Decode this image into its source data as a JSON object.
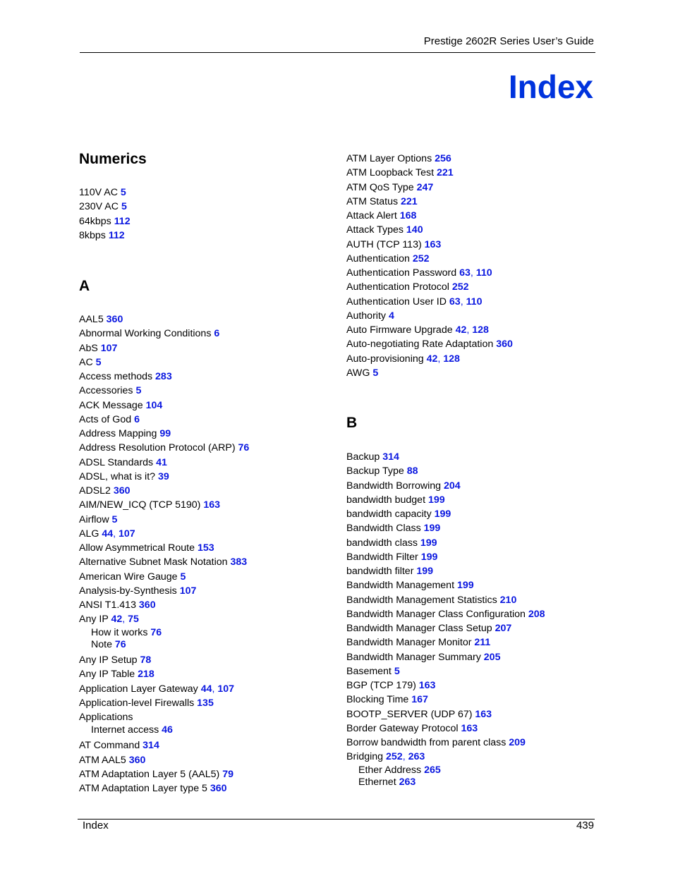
{
  "header": {
    "guide_title": "Prestige 2602R Series User’s Guide"
  },
  "page_title": "Index",
  "left_column": {
    "sections": [
      {
        "heading": "Numerics",
        "entries": [
          {
            "term": "110V AC",
            "pages": [
              "5"
            ]
          },
          {
            "term": "230V AC",
            "pages": [
              "5"
            ]
          },
          {
            "term": "64kbps",
            "pages": [
              "112"
            ]
          },
          {
            "term": "8kbps",
            "pages": [
              "112"
            ]
          }
        ]
      },
      {
        "heading": "A",
        "entries": [
          {
            "term": "AAL5",
            "pages": [
              "360"
            ]
          },
          {
            "term": "Abnormal Working Conditions",
            "pages": [
              "6"
            ]
          },
          {
            "term": "AbS",
            "pages": [
              "107"
            ]
          },
          {
            "term": "AC",
            "pages": [
              "5"
            ]
          },
          {
            "term": "Access methods",
            "pages": [
              "283"
            ]
          },
          {
            "term": "Accessories",
            "pages": [
              "5"
            ]
          },
          {
            "term": "ACK Message",
            "pages": [
              "104"
            ]
          },
          {
            "term": "Acts of God",
            "pages": [
              "6"
            ]
          },
          {
            "term": "Address Mapping",
            "pages": [
              "99"
            ]
          },
          {
            "term": "Address Resolution Protocol (ARP)",
            "pages": [
              "76"
            ]
          },
          {
            "term": "ADSL Standards",
            "pages": [
              "41"
            ]
          },
          {
            "term": "ADSL, what is it?",
            "pages": [
              "39"
            ]
          },
          {
            "term": "ADSL2",
            "pages": [
              "360"
            ]
          },
          {
            "term": "AIM/NEW_ICQ (TCP 5190)",
            "pages": [
              "163"
            ]
          },
          {
            "term": "Airflow",
            "pages": [
              "5"
            ]
          },
          {
            "term": "ALG",
            "pages": [
              "44",
              "107"
            ]
          },
          {
            "term": "Allow Asymmetrical Route",
            "pages": [
              "153"
            ]
          },
          {
            "term": "Alternative Subnet Mask Notation",
            "pages": [
              "383"
            ]
          },
          {
            "term": "American Wire Gauge",
            "pages": [
              "5"
            ]
          },
          {
            "term": "Analysis-by-Synthesis",
            "pages": [
              "107"
            ]
          },
          {
            "term": "ANSI T1.413",
            "pages": [
              "360"
            ]
          },
          {
            "term": "Any IP",
            "pages": [
              "42",
              "75"
            ]
          },
          {
            "term": "How it works",
            "pages": [
              "76"
            ],
            "sub": true
          },
          {
            "term": "Note",
            "pages": [
              "76"
            ],
            "sub": true
          },
          {
            "term": "Any IP Setup",
            "pages": [
              "78"
            ],
            "after_sub": true
          },
          {
            "term": "Any IP Table",
            "pages": [
              "218"
            ]
          },
          {
            "term": "Application Layer Gateway",
            "pages": [
              "44",
              "107"
            ]
          },
          {
            "term": "Application-level Firewalls",
            "pages": [
              "135"
            ]
          },
          {
            "term": "Applications",
            "pages": []
          },
          {
            "term": "Internet access",
            "pages": [
              "46"
            ],
            "sub": true
          },
          {
            "term": "AT Command",
            "pages": [
              "314"
            ],
            "after_sub": true
          },
          {
            "term": "ATM AAL5",
            "pages": [
              "360"
            ]
          },
          {
            "term": "ATM Adaptation Layer 5 (AAL5)",
            "pages": [
              "79"
            ]
          },
          {
            "term": "ATM Adaptation Layer type 5",
            "pages": [
              "360"
            ]
          }
        ]
      }
    ]
  },
  "right_column": {
    "sections": [
      {
        "heading": "",
        "entries": [
          {
            "term": "ATM Layer Options",
            "pages": [
              "256"
            ]
          },
          {
            "term": "ATM Loopback Test",
            "pages": [
              "221"
            ]
          },
          {
            "term": "ATM QoS Type",
            "pages": [
              "247"
            ]
          },
          {
            "term": "ATM Status",
            "pages": [
              "221"
            ]
          },
          {
            "term": "Attack Alert",
            "pages": [
              "168"
            ]
          },
          {
            "term": "Attack Types",
            "pages": [
              "140"
            ]
          },
          {
            "term": "AUTH (TCP 113)",
            "pages": [
              "163"
            ]
          },
          {
            "term": "Authentication",
            "pages": [
              "252"
            ]
          },
          {
            "term": "Authentication Password",
            "pages": [
              "63",
              "110"
            ]
          },
          {
            "term": "Authentication Protocol",
            "pages": [
              "252"
            ]
          },
          {
            "term": "Authentication User ID",
            "pages": [
              "63",
              "110"
            ]
          },
          {
            "term": "Authority",
            "pages": [
              "4"
            ]
          },
          {
            "term": "Auto Firmware Upgrade",
            "pages": [
              "42",
              "128"
            ]
          },
          {
            "term": "Auto-negotiating Rate Adaptation",
            "pages": [
              "360"
            ]
          },
          {
            "term": "Auto-provisioning",
            "pages": [
              "42",
              "128"
            ]
          },
          {
            "term": "AWG",
            "pages": [
              "5"
            ]
          }
        ]
      },
      {
        "heading": "B",
        "entries": [
          {
            "term": "Backup",
            "pages": [
              "314"
            ]
          },
          {
            "term": "Backup Type",
            "pages": [
              "88"
            ]
          },
          {
            "term": "Bandwidth Borrowing",
            "pages": [
              "204"
            ]
          },
          {
            "term": "bandwidth budget",
            "pages": [
              "199"
            ]
          },
          {
            "term": "bandwidth capacity",
            "pages": [
              "199"
            ]
          },
          {
            "term": "Bandwidth Class",
            "pages": [
              "199"
            ]
          },
          {
            "term": "bandwidth class",
            "pages": [
              "199"
            ]
          },
          {
            "term": "Bandwidth Filter",
            "pages": [
              "199"
            ]
          },
          {
            "term": "bandwidth filter",
            "pages": [
              "199"
            ]
          },
          {
            "term": "Bandwidth Management",
            "pages": [
              "199"
            ]
          },
          {
            "term": "Bandwidth Management Statistics",
            "pages": [
              "210"
            ]
          },
          {
            "term": "Bandwidth Manager Class Configuration",
            "pages": [
              "208"
            ]
          },
          {
            "term": "Bandwidth Manager Class Setup",
            "pages": [
              "207"
            ]
          },
          {
            "term": "Bandwidth Manager Monitor",
            "pages": [
              "211"
            ]
          },
          {
            "term": "Bandwidth Manager Summary",
            "pages": [
              "205"
            ]
          },
          {
            "term": "Basement",
            "pages": [
              "5"
            ]
          },
          {
            "term": "BGP (TCP 179)",
            "pages": [
              "163"
            ]
          },
          {
            "term": "Blocking Time",
            "pages": [
              "167"
            ]
          },
          {
            "term": "BOOTP_SERVER (UDP 67)",
            "pages": [
              "163"
            ]
          },
          {
            "term": "Border Gateway Protocol",
            "pages": [
              "163"
            ]
          },
          {
            "term": "Borrow bandwidth from parent class",
            "pages": [
              "209"
            ]
          },
          {
            "term": "Bridging",
            "pages": [
              "252",
              "263"
            ]
          },
          {
            "term": "Ether Address",
            "pages": [
              "265"
            ],
            "sub": true
          },
          {
            "term": "Ethernet",
            "pages": [
              "263"
            ],
            "sub": true
          }
        ]
      }
    ]
  },
  "footer": {
    "section_name": "Index",
    "page_number": "439"
  }
}
